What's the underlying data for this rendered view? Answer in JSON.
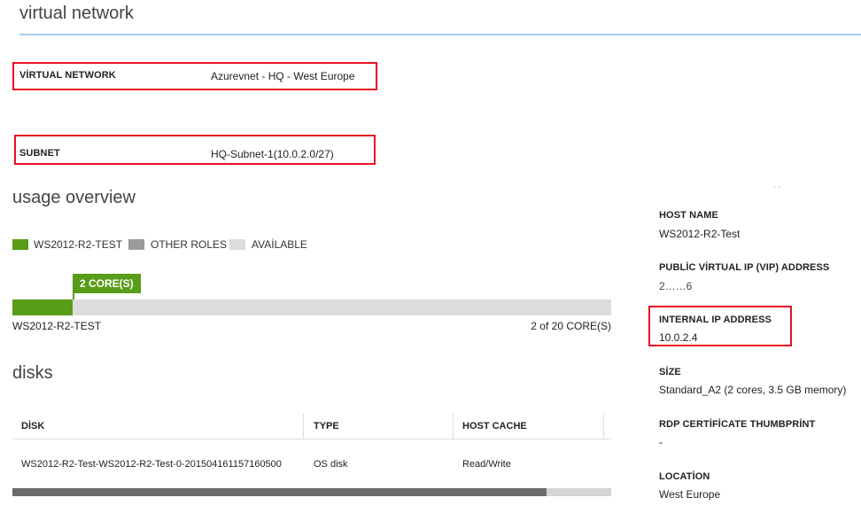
{
  "header": {
    "title": "virtual network"
  },
  "network": {
    "virtual_network_label": "VİRTUAL NETWORK",
    "virtual_network_value": "Azurevnet - HQ - West Europe",
    "subnet_label": "SUBNET",
    "subnet_value": "HQ-Subnet-1(10.0.2.0/27)"
  },
  "usage": {
    "title": "usage overview",
    "legend": [
      {
        "label": "WS2012-R2-TEST",
        "color": "#589c1a"
      },
      {
        "label": "OTHER ROLES",
        "color": "#9b9b9b"
      },
      {
        "label": "AVAİLABLE",
        "color": "#dcdcdc"
      }
    ],
    "tag": "2 CORE(S)",
    "used_cores": 2,
    "total_cores": 20,
    "bar_label": "WS2012-R2-TEST",
    "bar_summary": "2 of 20 CORE(S)"
  },
  "disks": {
    "title": "disks",
    "columns": [
      "DİSK",
      "TYPE",
      "HOST CACHE"
    ],
    "rows": [
      {
        "disk": "WS2012-R2-Test-WS2012-R2-Test-0-201504161157160500",
        "type": "OS disk",
        "host_cache": "Read/Write"
      }
    ]
  },
  "properties": {
    "host_name_label": "HOST NAME",
    "host_name_value": "WS2012-R2-Test",
    "public_vip_label": "PUBLİC VİRTUAL IP (VIP) ADDRESS",
    "public_vip_value": "2……6",
    "internal_ip_label": "INTERNAL IP ADDRESS",
    "internal_ip_value": "10.0.2.4",
    "size_label": "SİZE",
    "size_value": "Standard_A2 (2 cores, 3.5 GB memory)",
    "rdp_label": "RDP CERTİFİCATE THUMBPRİNT",
    "rdp_value": "-",
    "location_label": "LOCATİON",
    "location_value": "West Europe"
  },
  "colors": {
    "accent": "#589c1a",
    "highlight_border": "#e81123",
    "title_rule": "#a9cce8"
  }
}
